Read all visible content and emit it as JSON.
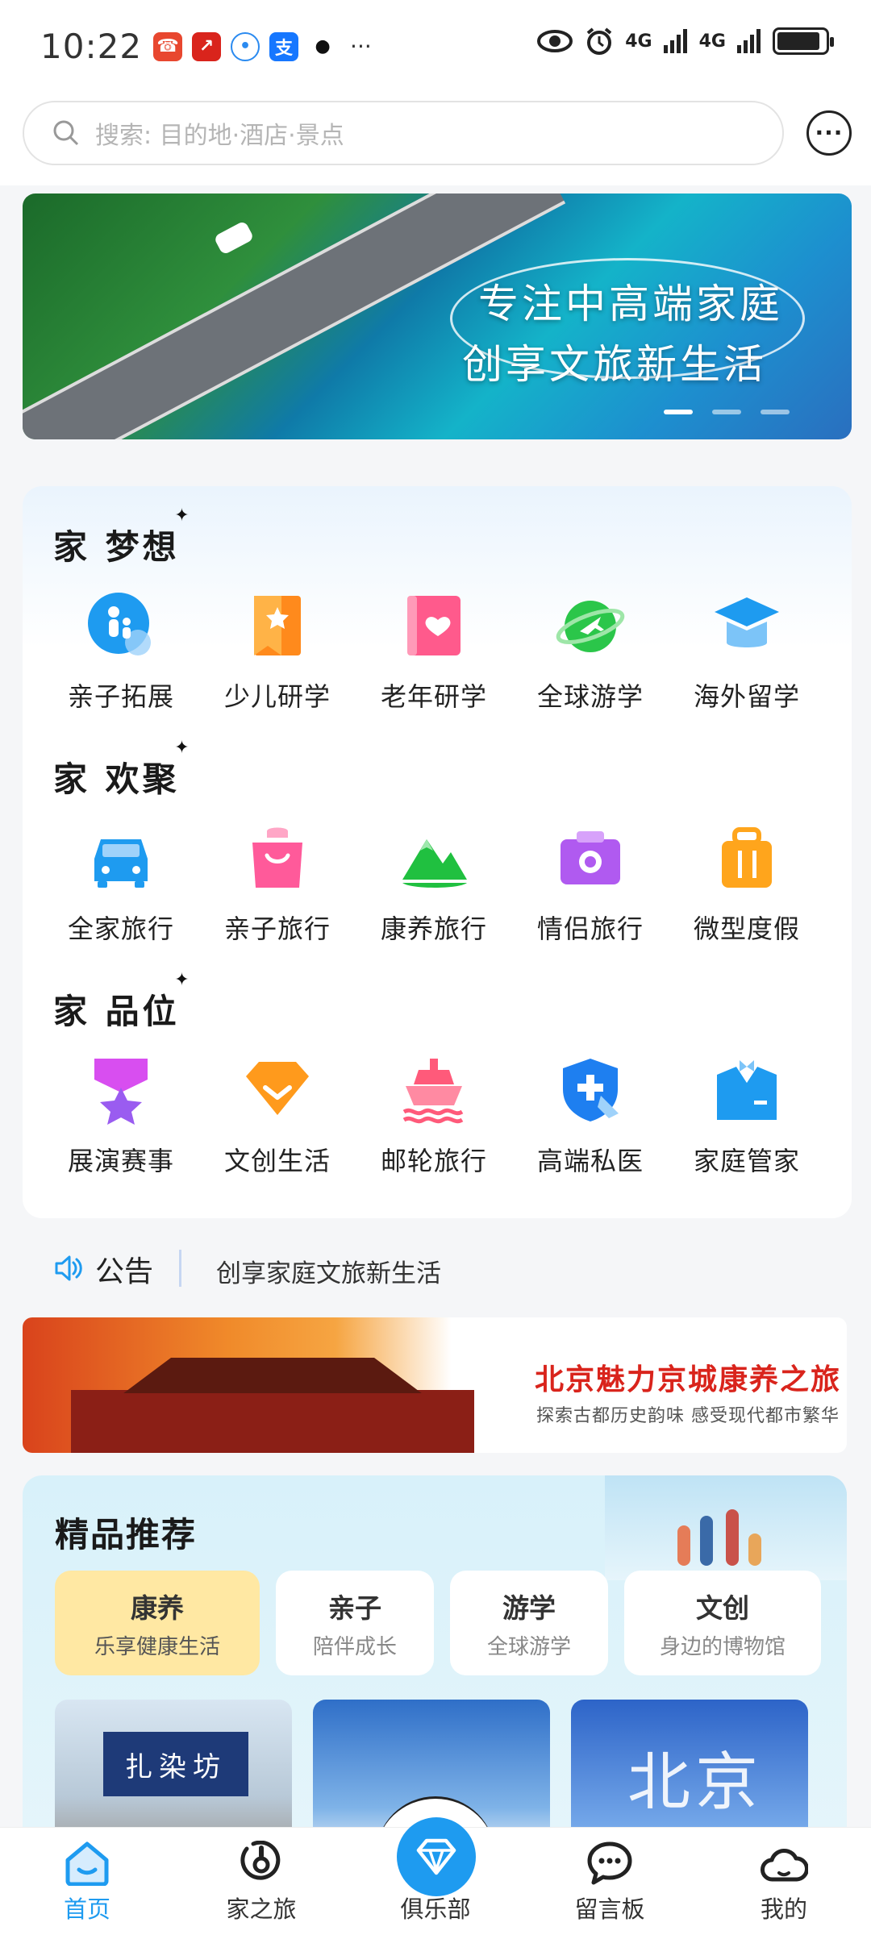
{
  "status_bar": {
    "time": "10:22",
    "more": "···",
    "signal1": "4G",
    "signal2": "4G"
  },
  "search": {
    "placeholder": "搜索: 目的地·酒店·景点",
    "more_label": "···"
  },
  "banner": {
    "line1": "专注中高端家庭",
    "line2": "创享文旅新生活",
    "pages": 3,
    "active_page": 1
  },
  "sections": [
    {
      "title": "家 梦想",
      "items": [
        {
          "label": "亲子拓展",
          "icon": "family-icon",
          "color": "#1e9bf0"
        },
        {
          "label": "少儿研学",
          "icon": "bookmark-star-icon",
          "color": "#ff8a1c"
        },
        {
          "label": "老年研学",
          "icon": "heart-book-icon",
          "color": "#ff5a8c"
        },
        {
          "label": "全球游学",
          "icon": "globe-plane-icon",
          "color": "#2bc64a"
        },
        {
          "label": "海外留学",
          "icon": "graduation-cap-icon",
          "color": "#1e9bf0"
        }
      ]
    },
    {
      "title": "家 欢聚",
      "items": [
        {
          "label": "全家旅行",
          "icon": "car-icon",
          "color": "#1e9bf0"
        },
        {
          "label": "亲子旅行",
          "icon": "shopping-bag-icon",
          "color": "#ff5a9a"
        },
        {
          "label": "康养旅行",
          "icon": "mountain-icon",
          "color": "#20c040"
        },
        {
          "label": "情侣旅行",
          "icon": "camera-icon",
          "color": "#b05af0"
        },
        {
          "label": "微型度假",
          "icon": "suitcase-icon",
          "color": "#ffa51c"
        }
      ]
    },
    {
      "title": "家 品位",
      "items": [
        {
          "label": "展演赛事",
          "icon": "medal-icon",
          "color": "#d84ef0"
        },
        {
          "label": "文创生活",
          "icon": "gem-box-icon",
          "color": "#ff9a1c"
        },
        {
          "label": "邮轮旅行",
          "icon": "cruise-ship-icon",
          "color": "#ff5a7a"
        },
        {
          "label": "高端私医",
          "icon": "medical-shield-icon",
          "color": "#1e7ff0"
        },
        {
          "label": "家庭管家",
          "icon": "butler-suit-icon",
          "color": "#1e9bf0"
        }
      ]
    }
  ],
  "notice": {
    "label": "公告",
    "text": "创享家庭文旅新生活"
  },
  "promo": {
    "title": "北京魅力京城康养之旅",
    "subtitle": "探索古都历史韵味  感受现代都市繁华"
  },
  "recommend": {
    "title": "精品推荐",
    "tabs": [
      {
        "label": "康养",
        "sub": "乐享健康生活",
        "active": true
      },
      {
        "label": "亲子",
        "sub": "陪伴成长",
        "active": false
      },
      {
        "label": "游学",
        "sub": "全球游学",
        "active": false
      },
      {
        "label": "文创",
        "sub": "身边的博物馆",
        "active": false
      }
    ],
    "thumb1_text": "扎染坊",
    "thumb3_text": "北京"
  },
  "nav": [
    {
      "label": "首页",
      "icon": "home-icon",
      "active": true
    },
    {
      "label": "家之旅",
      "icon": "journey-icon",
      "active": false
    },
    {
      "label": "俱乐部",
      "icon": "diamond-icon",
      "active": false
    },
    {
      "label": "留言板",
      "icon": "chat-bubble-icon",
      "active": false
    },
    {
      "label": "我的",
      "icon": "cloud-user-icon",
      "active": false
    }
  ],
  "colors": {
    "accent": "#1e9bf0",
    "active_chip": "#ffe8a3",
    "promo_red": "#d9241c"
  }
}
